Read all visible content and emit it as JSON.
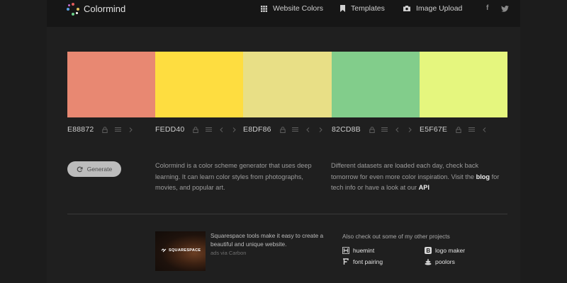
{
  "header": {
    "brand": "Colormind",
    "nav": [
      {
        "label": "Website Colors",
        "icon": "grid-icon"
      },
      {
        "label": "Templates",
        "icon": "bookmark-icon"
      },
      {
        "label": "Image Upload",
        "icon": "camera-icon"
      }
    ],
    "social": {
      "facebook": "f",
      "twitter": "twitter-icon"
    }
  },
  "palette": [
    {
      "hex": "E88872",
      "color": "#E88872",
      "arrows": 1
    },
    {
      "hex": "FEDD40",
      "color": "#FEDD40",
      "arrows": 2
    },
    {
      "hex": "E8DF86",
      "color": "#E8DF86",
      "arrows": 2
    },
    {
      "hex": "82CD8B",
      "color": "#82CD8B",
      "arrows": 2
    },
    {
      "hex": "E5F67E",
      "color": "#E5F67E",
      "arrows": 1
    }
  ],
  "generate": {
    "label": "Generate"
  },
  "description": {
    "left": "Colormind is a color scheme generator that uses deep learning. It can learn color styles from photographs, movies, and popular art.",
    "right_pre": "Different datasets are loaded each day, check back tomorrow for even more color inspiration. Visit the",
    "blog_link": "blog",
    "right_mid": "for tech info or have a look at our",
    "api_link": "API"
  },
  "ad": {
    "image_logo": "SQUARESPACE",
    "text": "Squarespace tools make it easy to create a beautiful and unique website.",
    "via": "ads via Carbon"
  },
  "projects": {
    "title": "Also check out some of my other projects",
    "items": [
      {
        "label": "huemint",
        "icon": "huemint-icon"
      },
      {
        "label": "logo maker",
        "icon": "logo-maker-icon"
      },
      {
        "label": "font pairing",
        "icon": "font-pairing-icon"
      },
      {
        "label": "poolors",
        "icon": "poolors-icon"
      }
    ]
  }
}
